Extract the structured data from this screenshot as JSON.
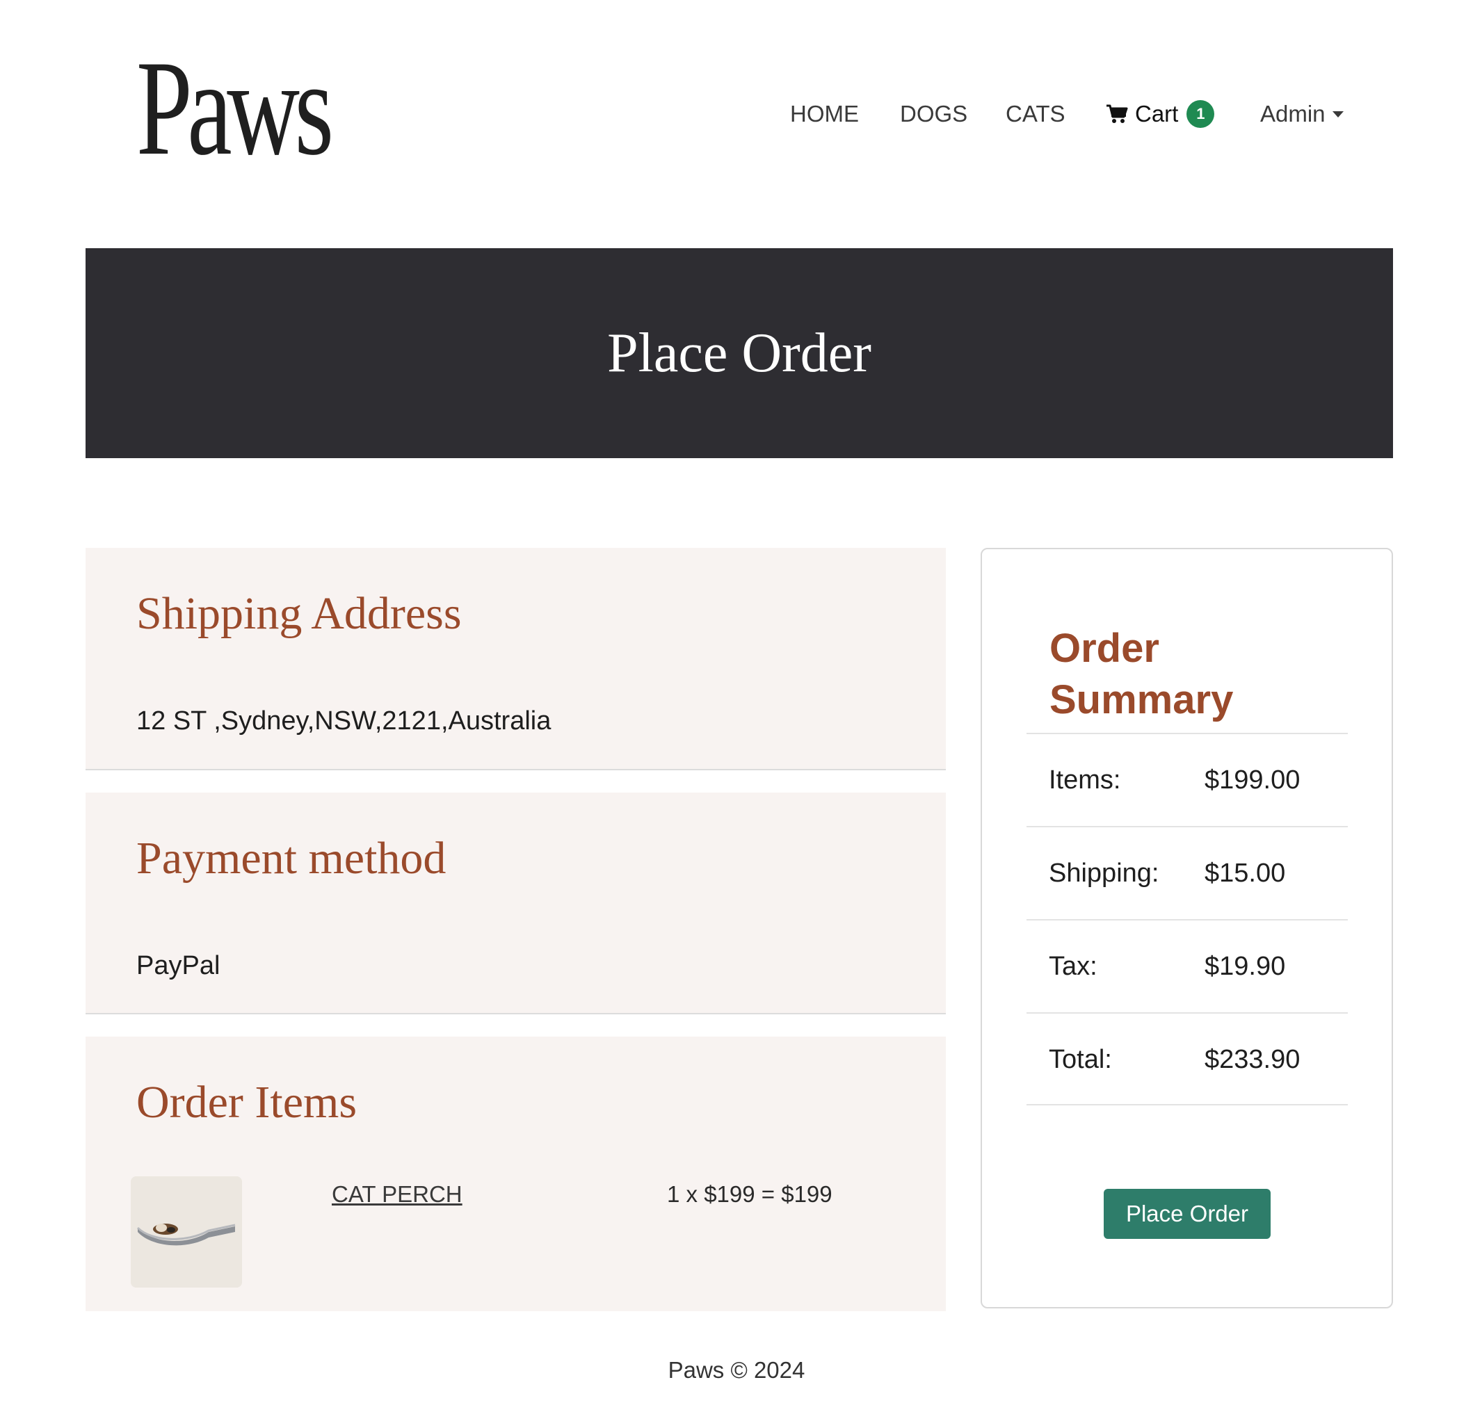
{
  "brand": {
    "logo_text": "Paws"
  },
  "nav": {
    "home": "HOME",
    "dogs": "DOGS",
    "cats": "CATS",
    "cart_label": "Cart",
    "cart_count": "1",
    "admin": "Admin"
  },
  "hero": {
    "title": "Place Order"
  },
  "shipping": {
    "title": "Shipping Address",
    "address": "12 ST ,Sydney,NSW,2121,Australia"
  },
  "payment": {
    "title": "Payment method",
    "method": "PayPal"
  },
  "order_items": {
    "title": "Order Items",
    "items": [
      {
        "name": "CAT PERCH",
        "price_line": "1 x $199 = $199"
      }
    ]
  },
  "summary": {
    "title": "Order Summary",
    "rows": [
      {
        "label": "Items:",
        "value": "$199.00"
      },
      {
        "label": "Shipping:",
        "value": "$15.00"
      },
      {
        "label": "Tax:",
        "value": "$19.90"
      },
      {
        "label": "Total:",
        "value": "$233.90"
      }
    ],
    "button_label": "Place Order"
  },
  "footer": {
    "text": "Paws © 2024"
  },
  "colors": {
    "hero_bg": "#2e2d32",
    "heading_accent": "#9a4a2b",
    "card_bg": "#f8f3f1",
    "badge": "#1f8a52",
    "primary_button": "#2e7d6a"
  }
}
